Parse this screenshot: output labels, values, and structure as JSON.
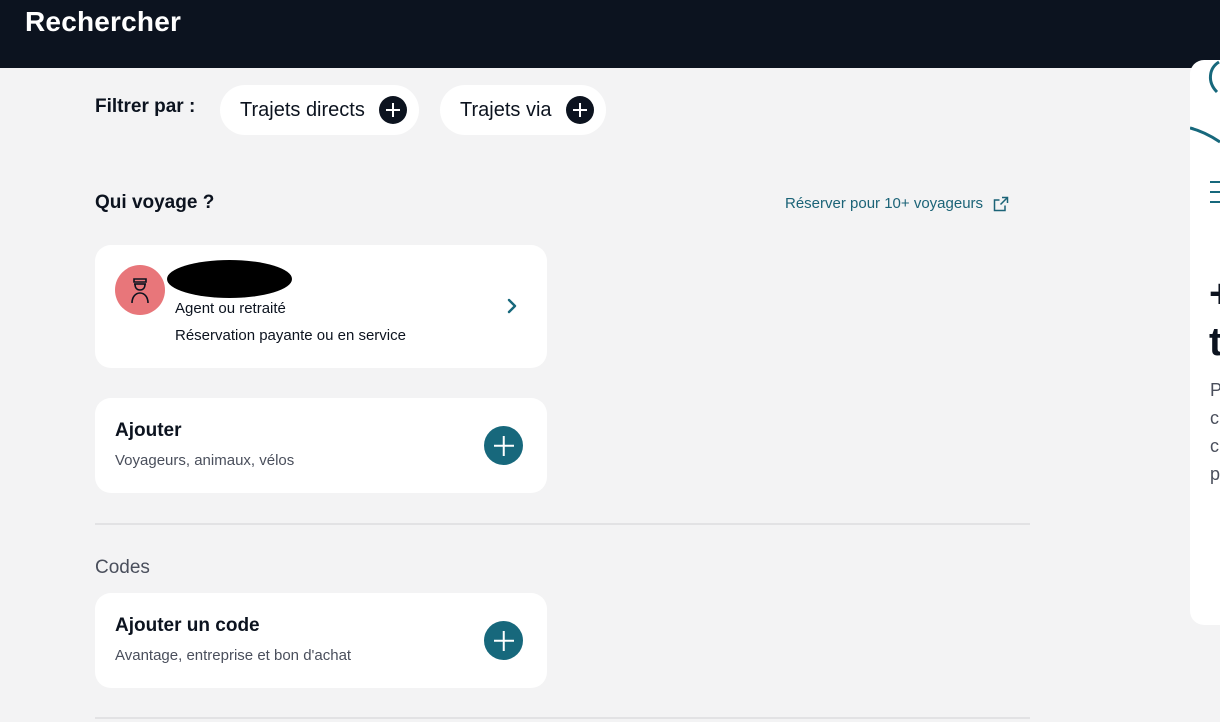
{
  "header": {
    "title": "Rechercher"
  },
  "filters": {
    "label": "Filtrer par :",
    "chips": [
      {
        "label": "Trajets directs",
        "icon": "plus-icon"
      },
      {
        "label": "Trajets via",
        "icon": "plus-icon"
      }
    ]
  },
  "travelers": {
    "title": "Qui voyage ?",
    "group_booking_link": "Réserver pour 10+ voyageurs",
    "group_booking_icon": "external-link-icon",
    "traveler": {
      "type": "Agent ou retraité",
      "description": "Réservation payante ou en service",
      "avatar_icon": "agent-icon",
      "avatar_color": "#e8767a"
    },
    "add": {
      "title": "Ajouter",
      "subtitle": "Voyageurs, animaux, vélos",
      "icon": "plus-circle-icon"
    }
  },
  "codes": {
    "title": "Codes",
    "add": {
      "title": "Ajouter un code",
      "subtitle": "Avantage, entreprise et bon d'achat",
      "icon": "plus-circle-icon"
    }
  },
  "side_panel": {
    "big_glyphs": [
      "+",
      "t"
    ],
    "small_glyphs": [
      "P",
      "c",
      "c",
      "p"
    ]
  },
  "colors": {
    "header_bg": "#0c131f",
    "page_bg": "#f3f3f4",
    "accent": "#17687c",
    "link": "#1b6377"
  }
}
